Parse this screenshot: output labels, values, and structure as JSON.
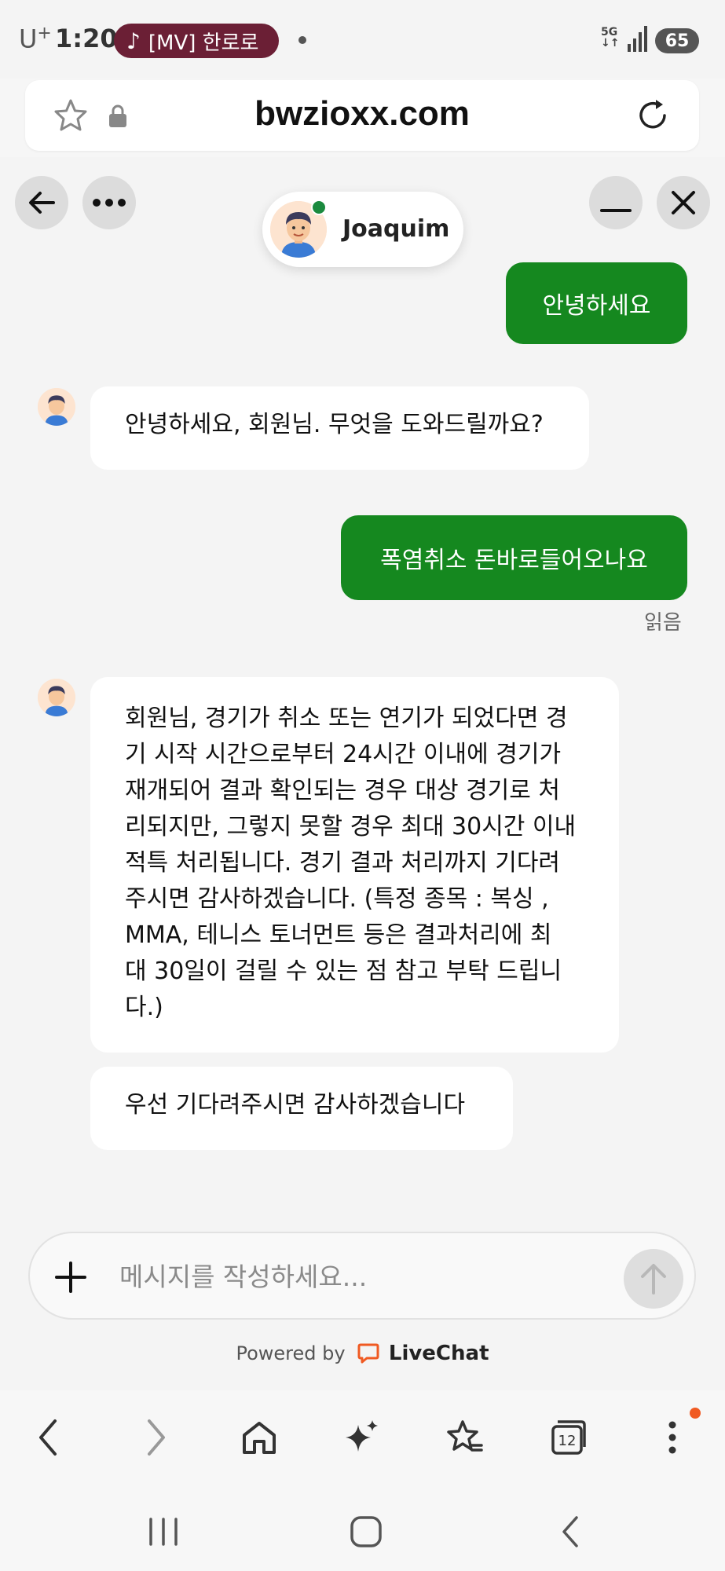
{
  "status_bar": {
    "carrier": "U",
    "carrier_sup": "+",
    "time": "1:20",
    "media_note_icon": "music-note-icon",
    "media_title": "[MV] 한로로",
    "network": "5G",
    "battery": "65"
  },
  "url_bar": {
    "url": "bwzioxx.com"
  },
  "chat": {
    "agent_name": "Joaquim",
    "messages": [
      {
        "from": "user",
        "text": "안녕하세요"
      },
      {
        "from": "agent",
        "text": "안녕하세요, 회원님. 무엇을 도와드릴까요?"
      },
      {
        "from": "user",
        "text": "폭염취소 돈바로들어오나요"
      },
      {
        "from": "agent",
        "text": "회원님, 경기가 취소 또는 연기가 되었다면 경기 시작 시간으로부터 24시간 이내에 경기가 재개되어 결과 확인되는 경우 대상 경기로 처리되지만, 그렇지 못할 경우 최대 30시간 이내 적특 처리됩니다. 경기 결과 처리까지 기다려 주시면 감사하겠습니다. (특정 종목 : 복싱 , MMA, 테니스 토너먼트 등은 결과처리에 최대 30일이 걸릴 수 있는 점 참고 부탁 드립니다.)"
      },
      {
        "from": "agent",
        "text": "우선 기다려주시면 감사하겠습니다"
      }
    ],
    "agent_long_lines": [
      "회원님, 경기가 취소 또는 연기가 되었다면 경",
      "기 시작 시간으로부터 24시간 이내에 경기가",
      "재개되어 결과 확인되는 경우 대상 경기로 처",
      "리되지만, 그렇지 못할 경우 최대 30시간 이내",
      "적특 처리됩니다. 경기 결과 처리까지 기다려",
      "주시면 감사하겠습니다. (특정 종목 : 복싱 ,",
      "MMA, 테니스 토너먼트 등은 결과처리에 최",
      "대 30일이 걸릴 수 있는 점 참고 부탁 드립니",
      "다.)"
    ],
    "read_receipt": "읽음",
    "composer_placeholder": "메시지를 작성하세요...",
    "powered_by": "Powered by",
    "brand": "LiveChat"
  },
  "browser_nav": {
    "tab_count": "12"
  },
  "colors": {
    "user_bubble": "#15881f",
    "online_dot": "#1b8a3e",
    "livechat_brand": "#f05a22",
    "notification_dot": "#f05a22"
  }
}
